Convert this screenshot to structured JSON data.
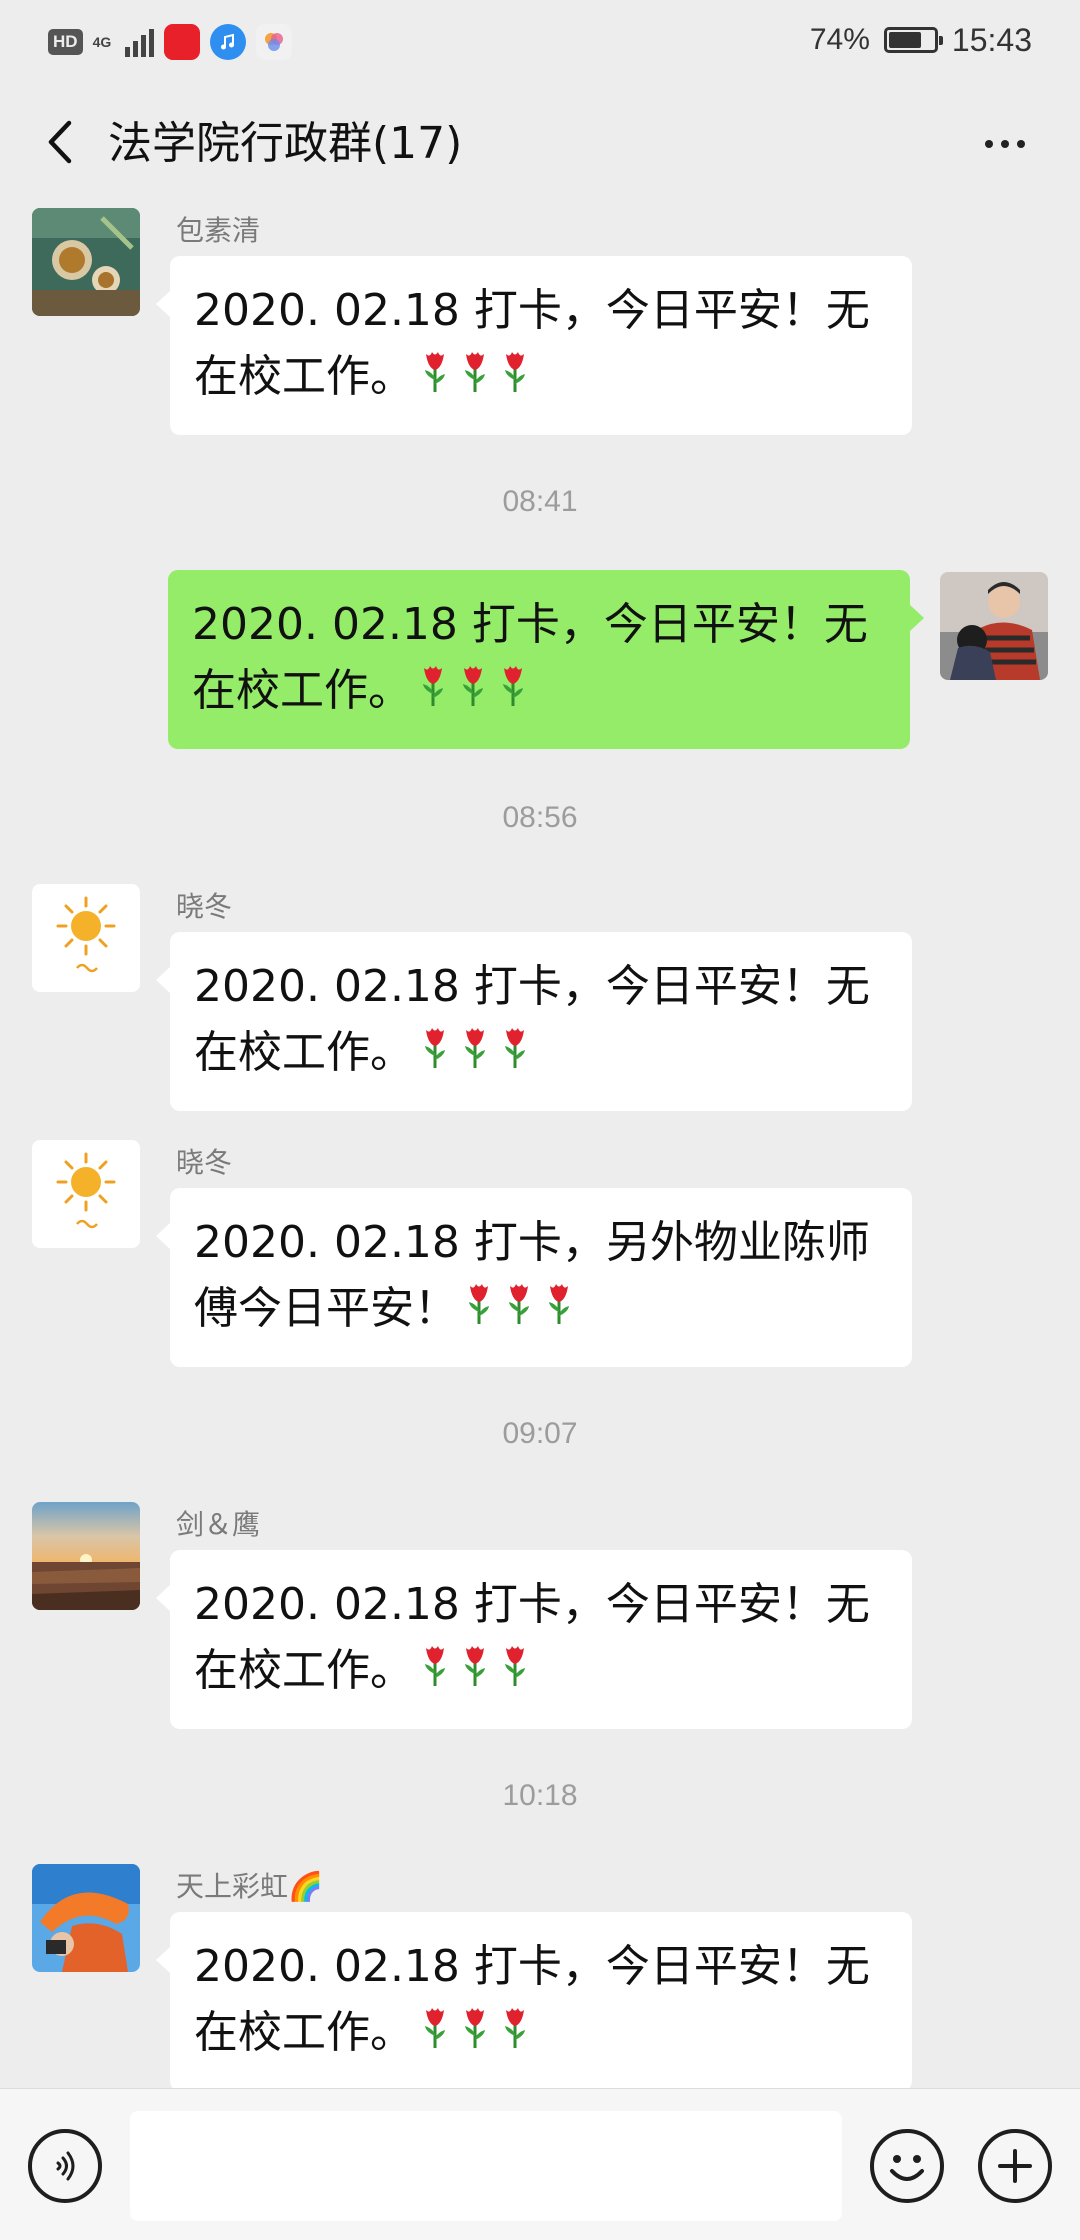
{
  "status_bar": {
    "hd": "HD",
    "network": "4G",
    "battery_pct": "74%",
    "battery_level": 0.74,
    "time": "15:43"
  },
  "header": {
    "title": "法学院行政群(17)"
  },
  "messages": [
    {
      "sender": "包素清",
      "text": "2020. 02.18 打卡，今日平安！无在校工作。",
      "mine": false,
      "avatar": "tea-photo"
    },
    {
      "time": "08:41"
    },
    {
      "sender": "",
      "text": "2020. 02.18 打卡，今日平安！无在校工作。",
      "mine": true,
      "avatar": "self-photo"
    },
    {
      "time": "08:56"
    },
    {
      "sender": "晓冬",
      "text": "2020. 02.18 打卡，今日平安！无在校工作。",
      "mine": false,
      "avatar": "sun-drawing"
    },
    {
      "sender": "晓冬",
      "text": "2020. 02.18 打卡，另外物业陈师傅今日平安！",
      "mine": false,
      "avatar": "sun-drawing"
    },
    {
      "time": "09:07"
    },
    {
      "sender": "剑＆鹰",
      "text": "2020. 02.18 打卡，今日平安！无在校工作。",
      "mine": false,
      "avatar": "sunset-photo"
    },
    {
      "time": "10:18"
    },
    {
      "sender": "天上彩虹🌈",
      "text": "2020. 02.18 打卡，今日平安！无在校工作。",
      "mine": false,
      "avatar": "orange-hat-photo"
    }
  ],
  "emoji": "rose-emoji",
  "input": {
    "placeholder": ""
  },
  "colors": {
    "background": "#ededed",
    "my_bubble": "#95ec69",
    "other_bubble": "#ffffff",
    "timestamp": "#9c9c9c"
  }
}
